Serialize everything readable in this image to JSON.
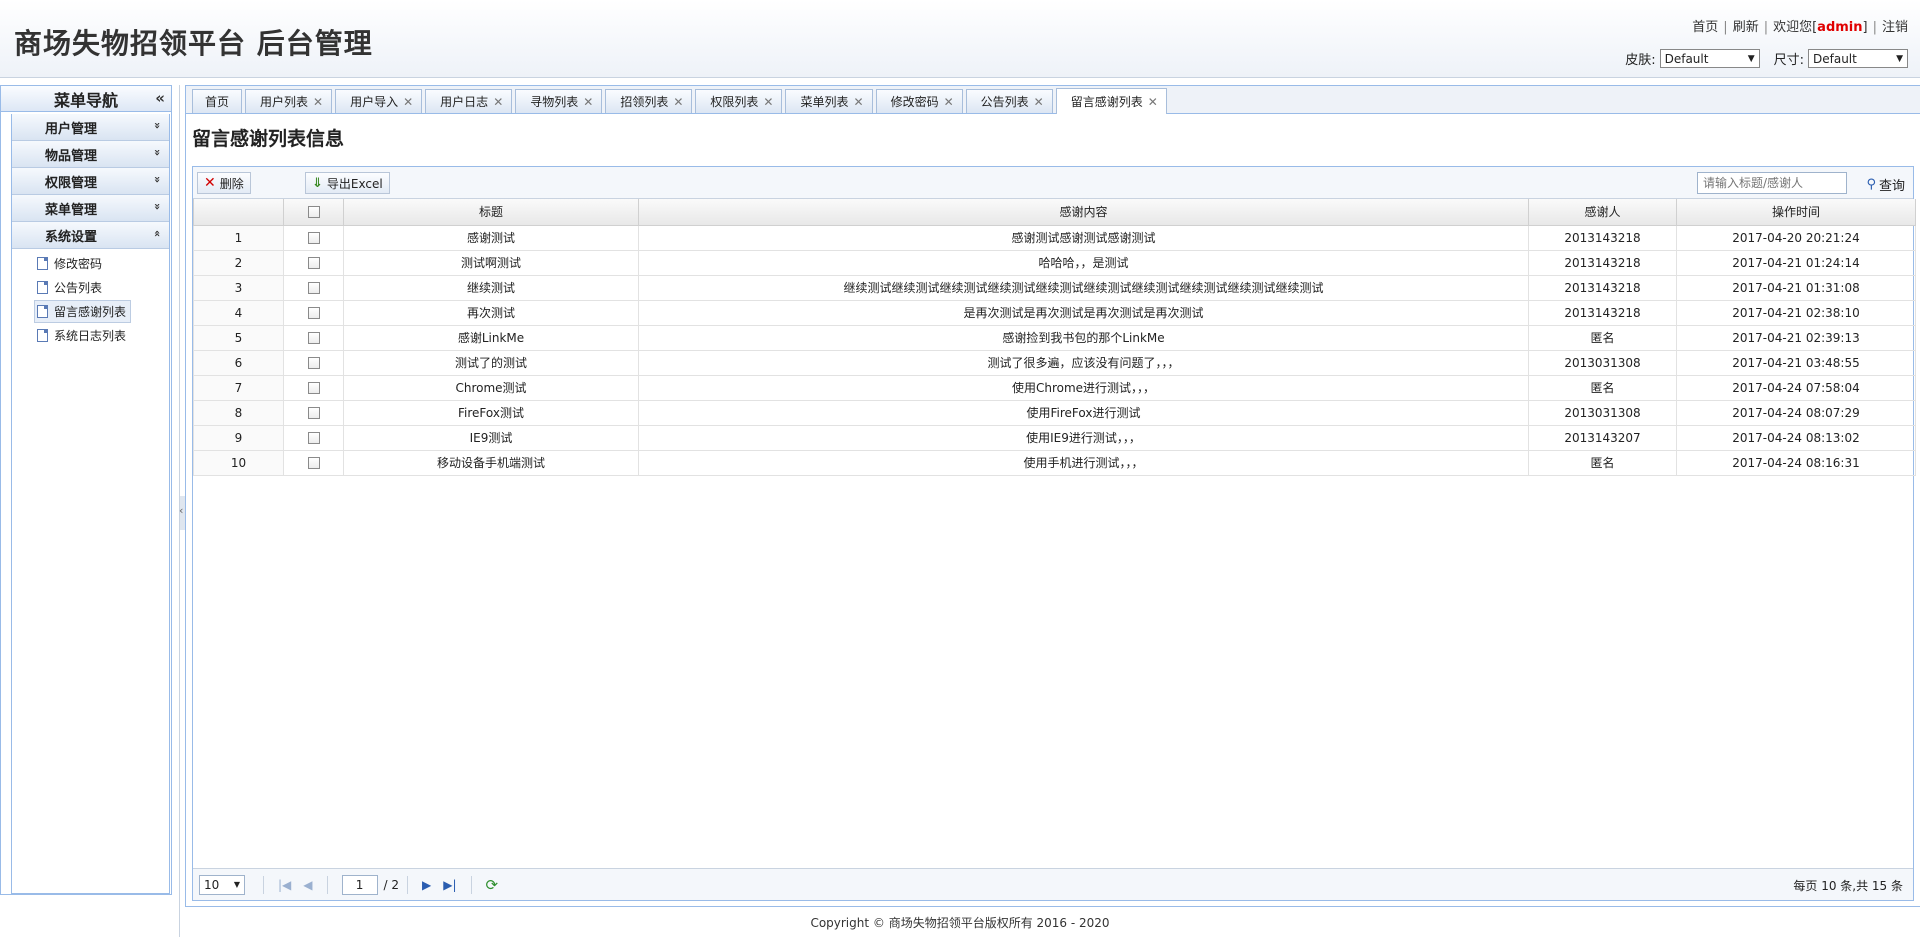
{
  "header": {
    "title": "商场失物招领平台 后台管理",
    "links": {
      "home": "首页",
      "refresh": "刷新",
      "welcome": "欢迎您[",
      "user": "admin",
      "close_bracket": "]",
      "logout": "注销"
    },
    "skin_label": "皮肤:",
    "skin_value": "Default",
    "size_label": "尺寸:",
    "size_value": "Default"
  },
  "sidebar": {
    "title": "菜单导航",
    "collapse_glyph": "«",
    "groups": [
      {
        "label": "用户管理",
        "chevron": "»"
      },
      {
        "label": "物品管理",
        "chevron": "»"
      },
      {
        "label": "权限管理",
        "chevron": "»"
      },
      {
        "label": "菜单管理",
        "chevron": "»"
      },
      {
        "label": "系统设置",
        "chevron": "«"
      }
    ],
    "items": [
      "修改密码",
      "公告列表",
      "留言感谢列表",
      "系统日志列表"
    ]
  },
  "tabs": [
    "首页",
    "用户列表",
    "用户导入",
    "用户日志",
    "寻物列表",
    "招领列表",
    "权限列表",
    "菜单列表",
    "修改密码",
    "公告列表",
    "留言感谢列表"
  ],
  "page": {
    "heading": "留言感谢列表信息",
    "toolbar": {
      "delete": "删除",
      "export": "导出Excel",
      "search_placeholder": "请输入标题/感谢人",
      "search": "查询"
    },
    "columns": [
      "标题",
      "感谢内容",
      "感谢人",
      "操作时间"
    ],
    "rows": [
      {
        "no": "1",
        "title": "感谢测试",
        "content": "感谢测试感谢测试感谢测试",
        "person": "2013143218",
        "time": "2017-04-20 20:21:24"
      },
      {
        "no": "2",
        "title": "测试啊测试",
        "content": "哈哈哈，，是测试",
        "person": "2013143218",
        "time": "2017-04-21 01:24:14"
      },
      {
        "no": "3",
        "title": "继续测试",
        "content": "继续测试继续测试继续测试继续测试继续测试继续测试继续测试继续测试继续测试继续测试",
        "person": "2013143218",
        "time": "2017-04-21 01:31:08"
      },
      {
        "no": "4",
        "title": "再次测试",
        "content": "是再次测试是再次测试是再次测试是再次测试",
        "person": "2013143218",
        "time": "2017-04-21 02:38:10"
      },
      {
        "no": "5",
        "title": "感谢LinkMe",
        "content": "感谢捡到我书包的那个LinkMe",
        "person": "匿名",
        "time": "2017-04-21 02:39:13"
      },
      {
        "no": "6",
        "title": "测试了的测试",
        "content": "测试了很多遍，应该没有问题了，，，",
        "person": "2013031308",
        "time": "2017-04-21 03:48:55"
      },
      {
        "no": "7",
        "title": "Chrome测试",
        "content": "使用Chrome进行测试，，，",
        "person": "匿名",
        "time": "2017-04-24 07:58:04"
      },
      {
        "no": "8",
        "title": "FireFox测试",
        "content": "使用FireFox进行测试",
        "person": "2013031308",
        "time": "2017-04-24 08:07:29"
      },
      {
        "no": "9",
        "title": "IE9测试",
        "content": "使用IE9进行测试，，，",
        "person": "2013143207",
        "time": "2017-04-24 08:13:02"
      },
      {
        "no": "10",
        "title": "移动设备手机端测试",
        "content": "使用手机进行测试，，，",
        "person": "匿名",
        "time": "2017-04-24 08:16:31"
      }
    ],
    "pager": {
      "page_size": "10",
      "current_page": "1",
      "total_pages": "/ 2",
      "info": "每页 10 条,共 15 条"
    }
  },
  "footer": "Copyright © 商场失物招领平台版权所有  2016 - 2020"
}
